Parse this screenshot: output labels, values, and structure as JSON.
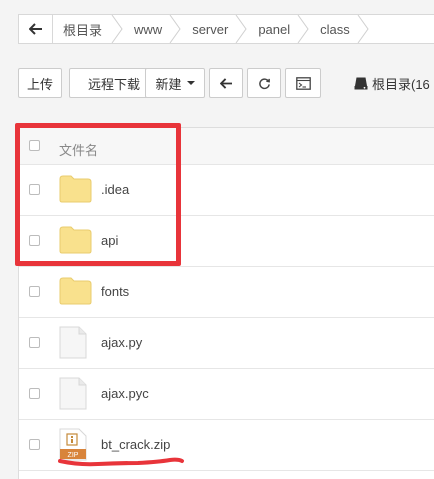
{
  "breadcrumb": {
    "items": [
      "根目录",
      "www",
      "server",
      "panel",
      "class"
    ]
  },
  "toolbar": {
    "upload_label": "上传",
    "remote_download_label": "远程下载",
    "new_label": "新建",
    "disk_label": "根目录(16"
  },
  "file_list": {
    "header_label": "文件名",
    "rows": [
      {
        "name": ".idea",
        "icon": "folder-icon"
      },
      {
        "name": "api",
        "icon": "folder-icon"
      },
      {
        "name": "fonts",
        "icon": "folder-icon"
      },
      {
        "name": "ajax.py",
        "icon": "file-icon"
      },
      {
        "name": "ajax.pyc",
        "icon": "file-icon"
      },
      {
        "name": "bt_crack.zip",
        "icon": "zip-icon"
      }
    ]
  },
  "icons": {
    "zip_badge": "ZIP"
  },
  "colors": {
    "annotation_red": "#e8343a",
    "folder_yellow": "#f9e18d"
  }
}
